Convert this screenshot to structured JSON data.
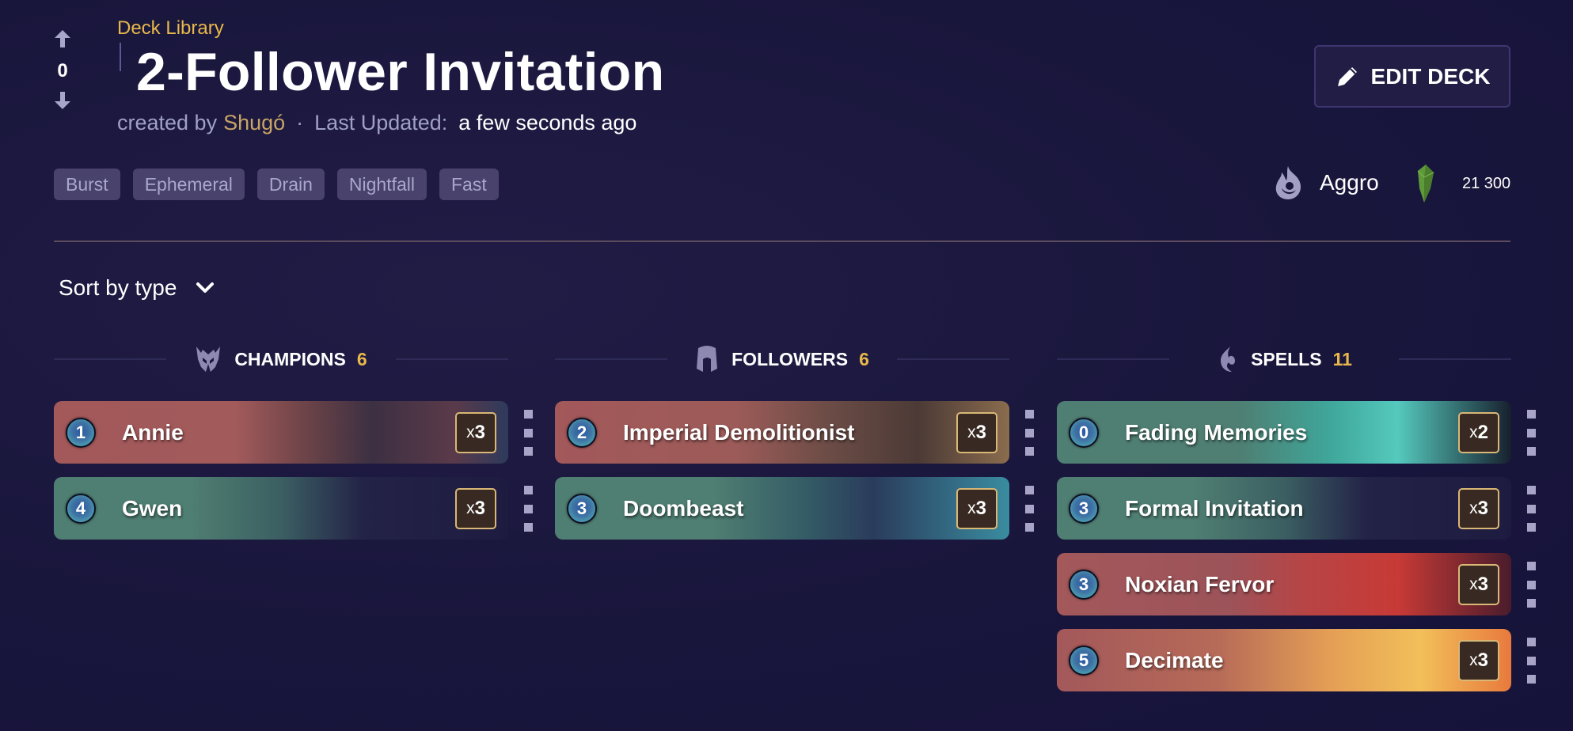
{
  "vote": {
    "count": "0",
    "up_icon": "arrow-up-icon",
    "down_icon": "arrow-down-icon"
  },
  "breadcrumb": "Deck Library",
  "title": "2-Follower Invitation",
  "meta": {
    "created_by_label": "created by",
    "author": "Shugó",
    "separator": "·",
    "updated_label": "Last Updated:",
    "updated_value": "a few seconds ago"
  },
  "edit_button": {
    "label": "EDIT DECK",
    "icon": "pencil-icon"
  },
  "tags": [
    "Burst",
    "Ephemeral",
    "Drain",
    "Nightfall",
    "Fast"
  ],
  "archetype": {
    "label": "Aggro",
    "icon": "flame-icon"
  },
  "shards": {
    "value": "21 300",
    "icon": "shard-icon"
  },
  "sort": {
    "label": "Sort by type",
    "icon": "chevron-down-icon"
  },
  "colors": {
    "accent_gold": "#e8b84a",
    "author": "#c8a465",
    "qty_border": "#d9b776",
    "tag_bg": "#48426c"
  },
  "columns": [
    {
      "name": "CHAMPIONS",
      "count": "6",
      "icon": "champion-helmet-icon",
      "cards": [
        {
          "cost": "1",
          "name": "Annie",
          "qty_prefix": "x",
          "qty": "3",
          "region": "red"
        },
        {
          "cost": "4",
          "name": "Gwen",
          "qty_prefix": "x",
          "qty": "3",
          "region": "green"
        }
      ]
    },
    {
      "name": "FOLLOWERS",
      "count": "6",
      "icon": "follower-helmet-icon",
      "cards": [
        {
          "cost": "2",
          "name": "Imperial Demolitionist",
          "qty_prefix": "x",
          "qty": "3",
          "region": "red"
        },
        {
          "cost": "3",
          "name": "Doombeast",
          "qty_prefix": "x",
          "qty": "3",
          "region": "green"
        }
      ]
    },
    {
      "name": "SPELLS",
      "count": "11",
      "icon": "spell-flame-icon",
      "cards": [
        {
          "cost": "0",
          "name": "Fading Memories",
          "qty_prefix": "x",
          "qty": "2",
          "region": "green"
        },
        {
          "cost": "3",
          "name": "Formal Invitation",
          "qty_prefix": "x",
          "qty": "3",
          "region": "green"
        },
        {
          "cost": "3",
          "name": "Noxian Fervor",
          "qty_prefix": "x",
          "qty": "3",
          "region": "red"
        },
        {
          "cost": "5",
          "name": "Decimate",
          "qty_prefix": "x",
          "qty": "3",
          "region": "red"
        }
      ]
    }
  ]
}
